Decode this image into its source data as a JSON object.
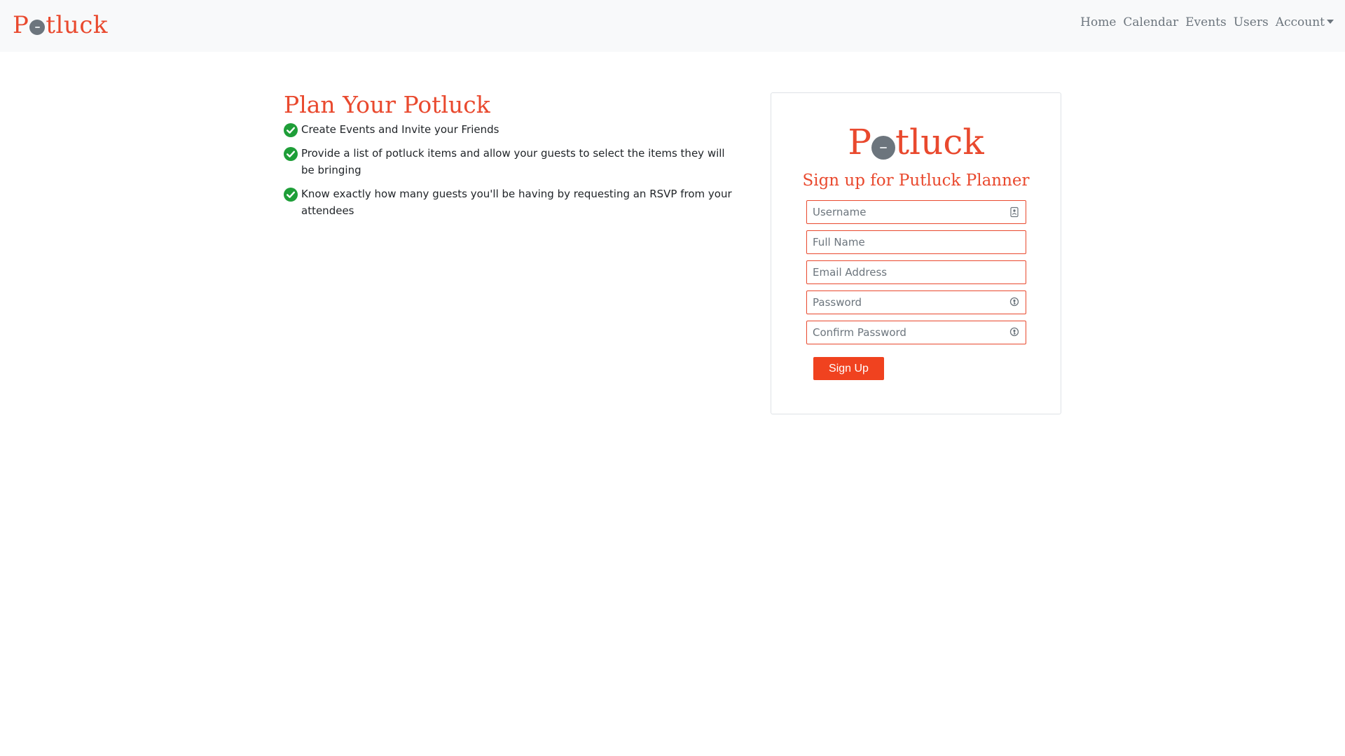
{
  "navbar": {
    "brand": {
      "before": "P",
      "after": "tluck",
      "icon": "pot-icon"
    },
    "links": [
      {
        "label": "Home"
      },
      {
        "label": "Calendar"
      },
      {
        "label": "Events"
      },
      {
        "label": "Users"
      },
      {
        "label": "Account",
        "dropdown": true
      }
    ]
  },
  "hero": {
    "title": "Plan Your Potluck",
    "features": [
      {
        "icon": "check-circle-icon",
        "text": "Create Events and Invite your Friends"
      },
      {
        "icon": "check-circle-icon",
        "text": "Provide a list of potluck items and allow your guests to select the items they will be bringing"
      },
      {
        "icon": "check-circle-icon",
        "text": "Know exactly how many guests you'll be having by requesting an RSVP from your attendees"
      }
    ]
  },
  "signup": {
    "logo": {
      "before": "P",
      "after": "tluck",
      "icon": "pot-icon"
    },
    "title": "Sign up for Putluck Planner",
    "fields": {
      "username": {
        "placeholder": "Username",
        "value": "",
        "icon": "contact-card-icon"
      },
      "full_name": {
        "placeholder": "Full Name",
        "value": ""
      },
      "email": {
        "placeholder": "Email Address",
        "value": ""
      },
      "password": {
        "placeholder": "Password",
        "value": "",
        "icon": "key-icon"
      },
      "confirm_password": {
        "placeholder": "Confirm Password",
        "value": "",
        "icon": "key-icon"
      }
    },
    "submit_label": "Sign Up"
  },
  "colors": {
    "brand": "#e9492e",
    "button": "#f0421f",
    "check": "#1e9e38",
    "navbar_bg": "#f8f9fa",
    "nav_text": "#6c757d"
  }
}
